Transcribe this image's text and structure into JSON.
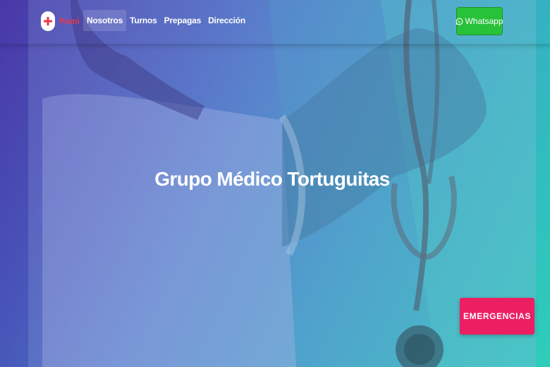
{
  "navbar": {
    "brand_label": "Pami",
    "links": [
      {
        "label": "Nosotros"
      },
      {
        "label": "Turnos"
      },
      {
        "label": "Prepagas"
      },
      {
        "label": "Dirección"
      }
    ],
    "whatsapp_label": "Whatsapp"
  },
  "hero": {
    "title": "Grupo Médico Tortuguitas"
  },
  "emergency": {
    "label": "EMERGENCIAS"
  },
  "colors": {
    "brand": "#e8364a",
    "whatsapp": "#28c13a",
    "emergency": "#ec1f63",
    "gradient_start": "#4a3aa8",
    "gradient_end": "#2fd0b8"
  },
  "icons": {
    "brand": "red-cross-icon",
    "whatsapp": "whatsapp-icon"
  }
}
